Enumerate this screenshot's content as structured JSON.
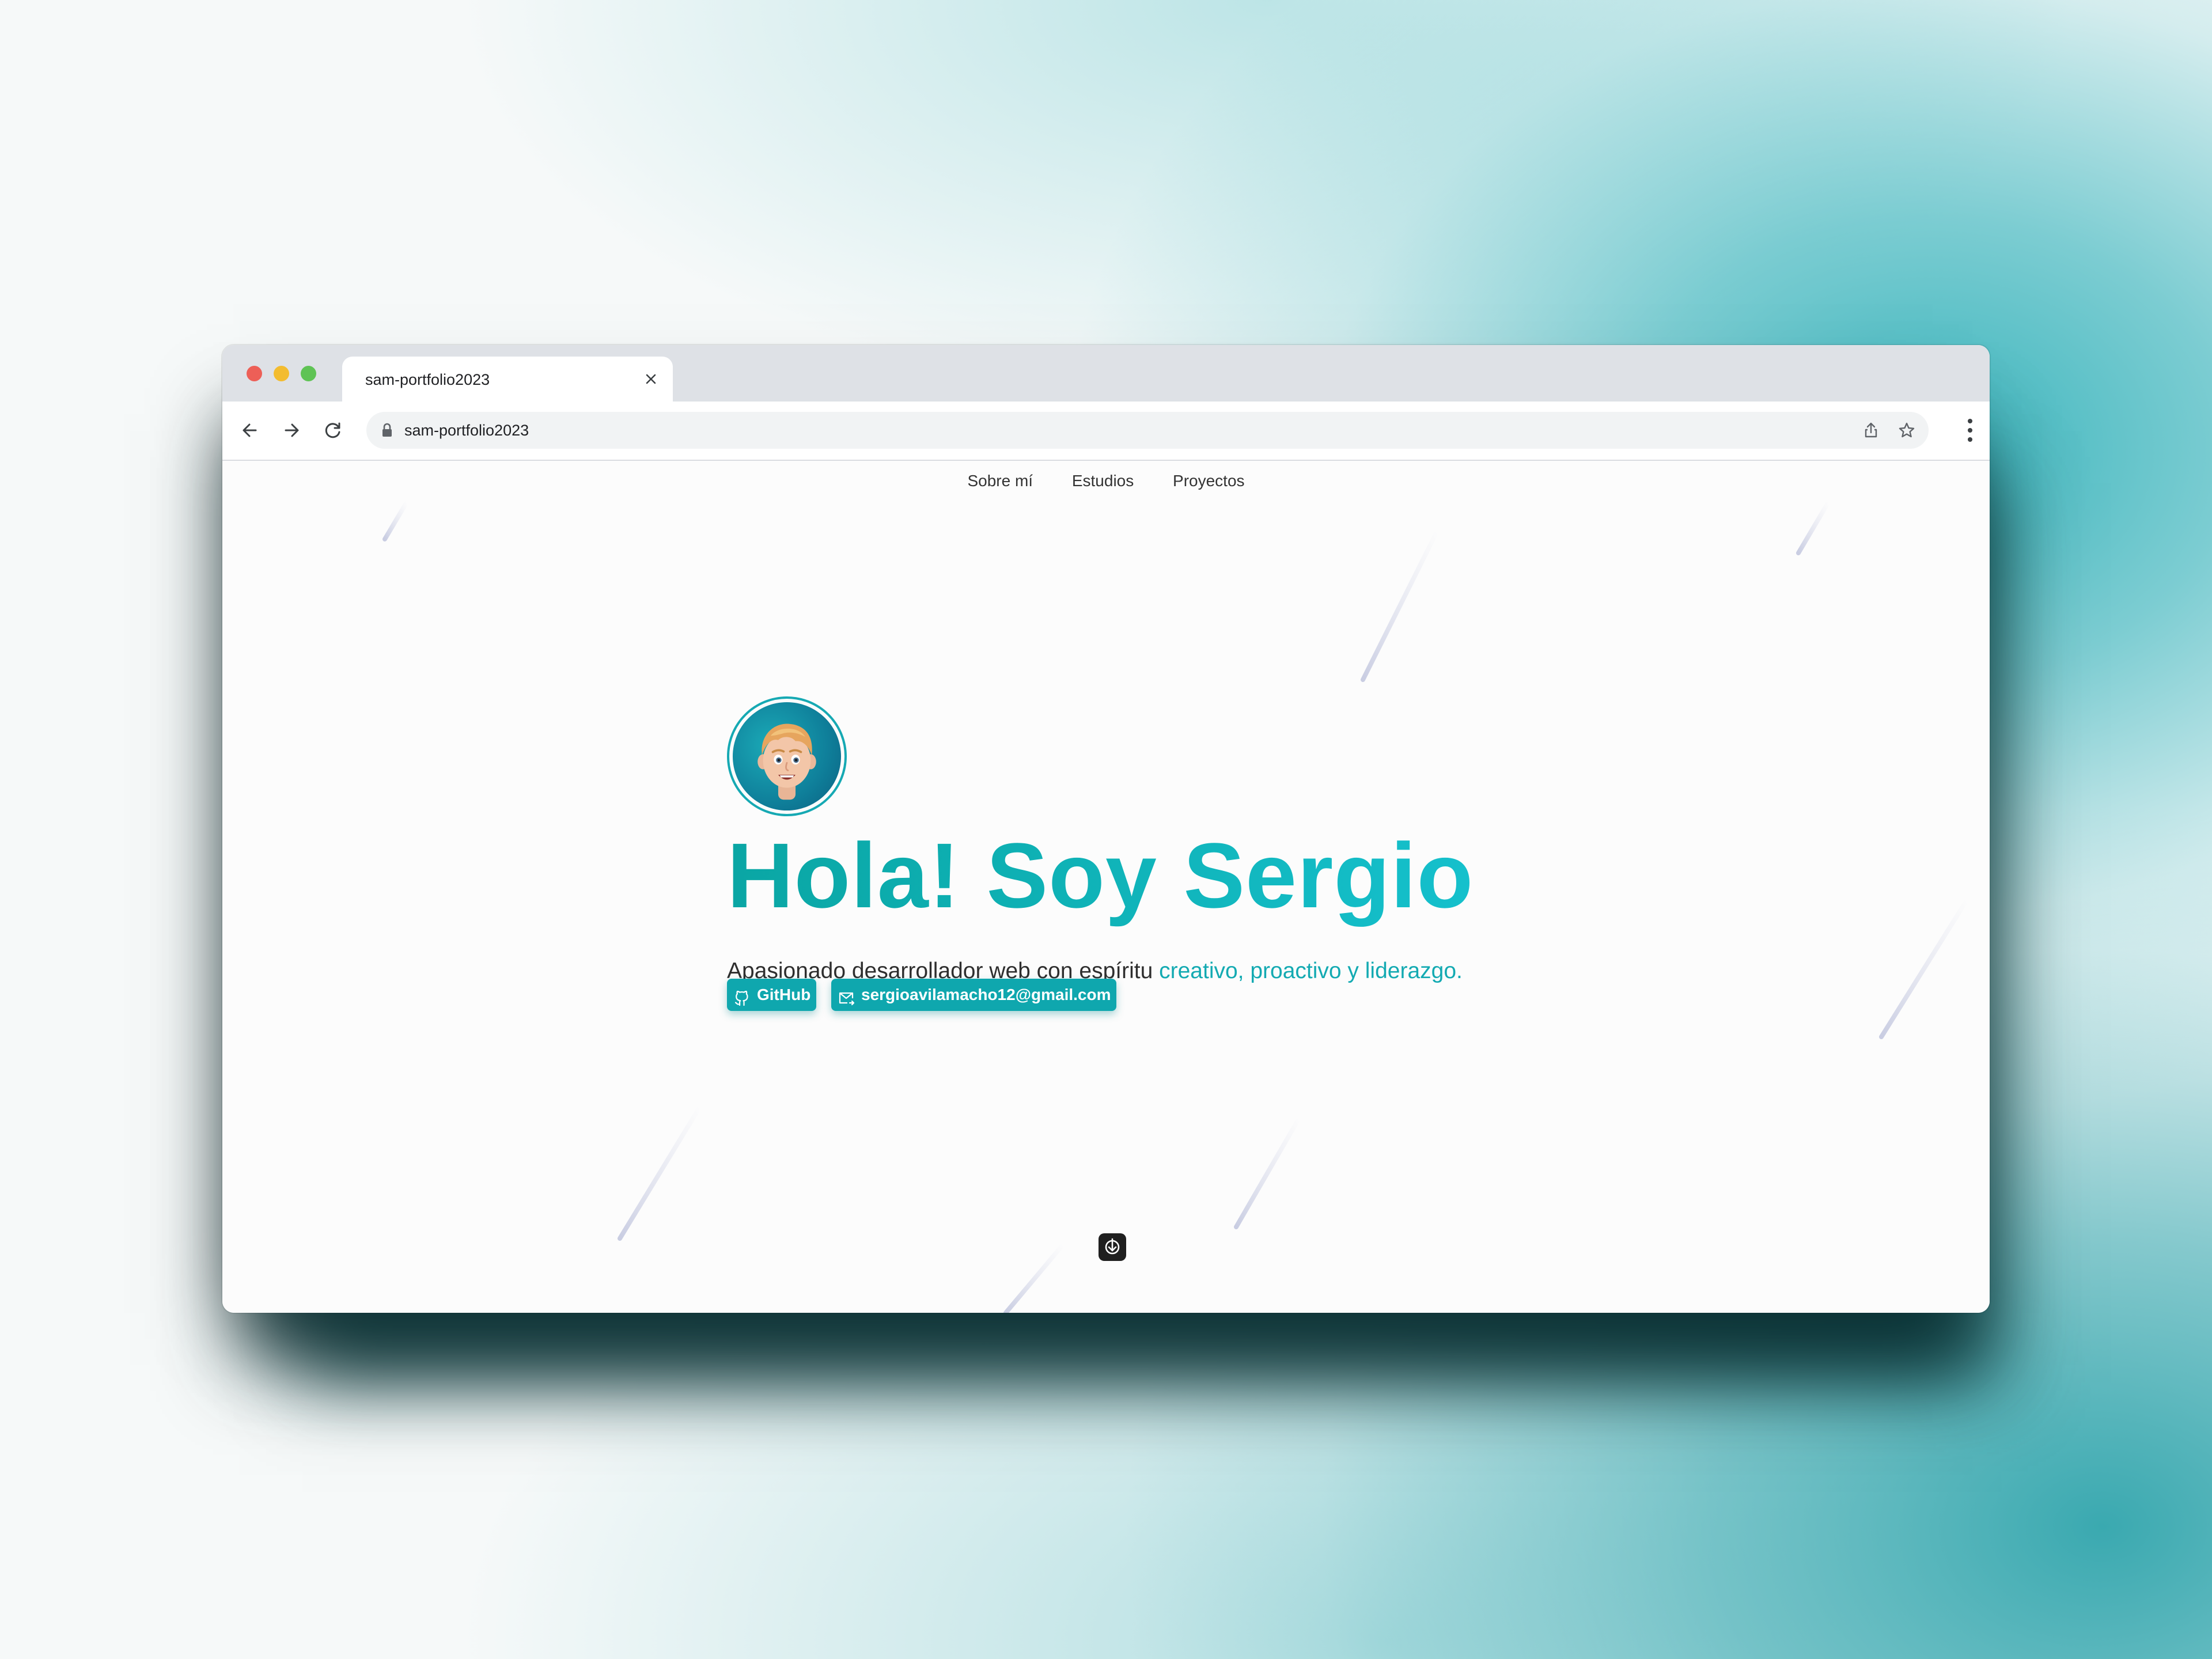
{
  "browser": {
    "tab_title": "sam-portfolio2023",
    "url": "sam-portfolio2023",
    "icons": {
      "close": "close-icon",
      "back": "arrow-left-icon",
      "forward": "arrow-right-icon",
      "reload": "reload-icon",
      "lock": "lock-icon",
      "share": "share-icon",
      "bookmark": "star-icon",
      "menu": "kebab-menu-icon"
    }
  },
  "site": {
    "nav": [
      "Sobre mí",
      "Estudios",
      "Proyectos"
    ],
    "hero": {
      "title": "Hola! Soy Sergio",
      "subtitle_plain": "Apasionado desarrollador web con espíritu ",
      "subtitle_accent": "creativo, proactivo y liderazgo."
    },
    "badges": {
      "github": "GitHub",
      "email": "sergioavilamacho12@gmail.com"
    },
    "colors": {
      "accent": "#0fa7ae",
      "title_gradient_start": "#0aa6a4",
      "title_gradient_end": "#15c0cc",
      "background": "#fcfcfc"
    }
  }
}
